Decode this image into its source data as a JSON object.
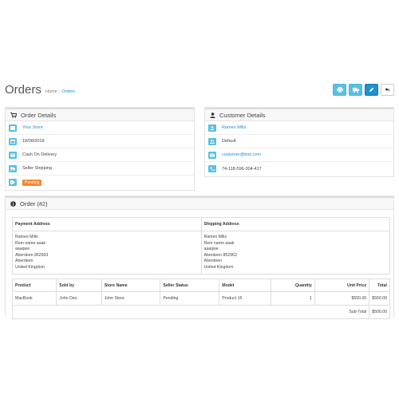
{
  "header": {
    "title": "Orders",
    "breadcrumb": [
      "Home",
      "Orders"
    ]
  },
  "order_details": {
    "title": "Order Details",
    "store": "Your Store",
    "date": "18/08/2018",
    "payment_method": "Cash On Delivery",
    "shipping_method": "Seller Shipping",
    "status": "Pending"
  },
  "customer_details": {
    "title": "Customer Details",
    "name": "Rameo Mills",
    "group": "Default",
    "email": "customer@test.com",
    "phone": "74-118-596-304-417"
  },
  "order": {
    "title": "Order (#2)",
    "payment_address_label": "Payment Address",
    "shipping_address_label": "Shipping Address",
    "payment_address": [
      "Rameo Mills",
      "Rem name aaak",
      "aaaqwe",
      "Aberdeen 852963",
      "Aberdeen",
      "United Kingdom"
    ],
    "shipping_address": [
      "Rameo Mills",
      "Rem name aaak",
      "aaaqwe",
      "Aberdeen 852963",
      "Aberdeen",
      "United Kingdom"
    ],
    "columns": [
      "Product",
      "Sold by",
      "Store Name",
      "Seller Status",
      "Model",
      "Quantity",
      "Unit Price",
      "Total"
    ],
    "rows": [
      {
        "product": "MacBook",
        "sold_by": "John Deo",
        "store_name": "John Store",
        "seller_status": "Pending",
        "model": "Product 16",
        "quantity": "1",
        "unit_price": "$550.00",
        "total": "$550.00"
      }
    ],
    "subtotal_label": "Sub-Total",
    "subtotal_value": "$500.00"
  },
  "colors": {
    "accent": "#1e91cf",
    "info": "#5bc0de",
    "status_pending": "#f38733"
  }
}
